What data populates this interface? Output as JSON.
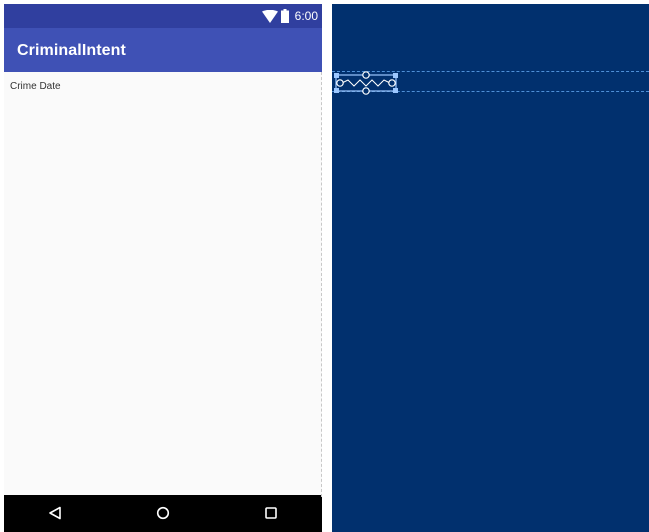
{
  "status_bar": {
    "time": "6:00",
    "icons": [
      "wifi-icon",
      "battery-icon"
    ]
  },
  "app_bar": {
    "title": "CriminalIntent"
  },
  "content": {
    "crime_date": "Crime Date"
  },
  "nav_bar": {
    "buttons": [
      "back-icon",
      "home-icon",
      "recents-icon"
    ]
  },
  "colors": {
    "status_bar": "#303f9f",
    "app_bar": "#3f51b5",
    "content_bg": "#fafafa",
    "nav_bar": "#000000",
    "blueprint_bg": "#01306e",
    "blueprint_guide": "#4f8fd6"
  }
}
